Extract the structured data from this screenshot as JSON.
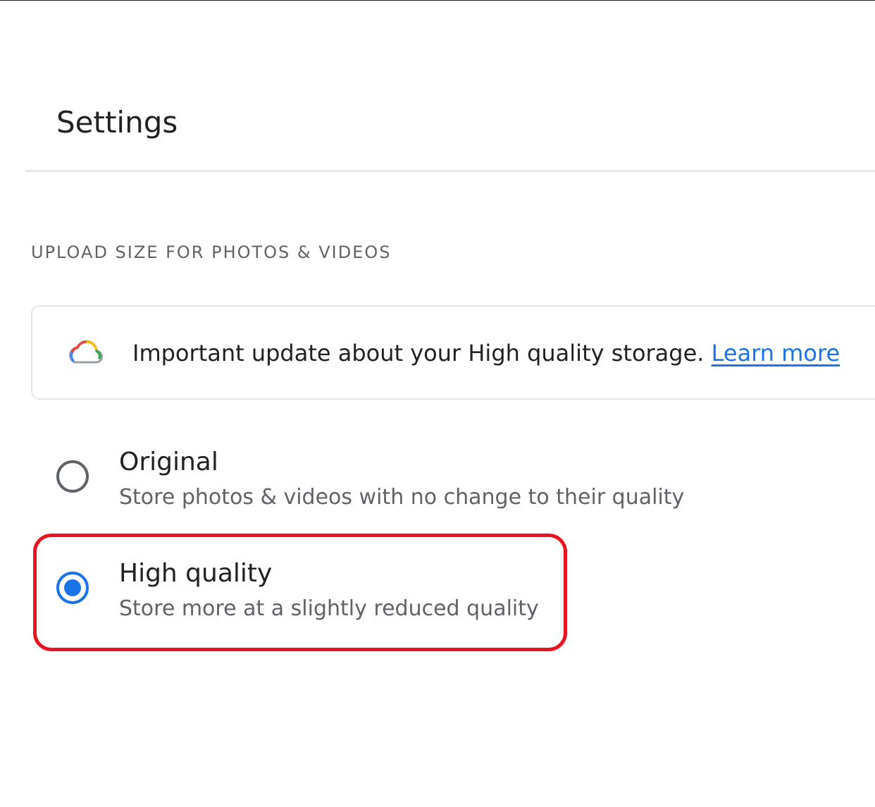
{
  "header": {
    "title": "Settings"
  },
  "section": {
    "heading": "UPLOAD SIZE FOR PHOTOS & VIDEOS"
  },
  "notice": {
    "icon": "cloud-icon",
    "text": "Important update about your High quality storage.",
    "link_label": "Learn more"
  },
  "options": [
    {
      "title": "Original",
      "description": "Store photos & videos with no change to their quality",
      "selected": false
    },
    {
      "title": "High quality",
      "description": "Store more at a slightly reduced quality",
      "selected": true
    }
  ],
  "colors": {
    "accent": "#1a73e8",
    "highlight_outline": "#e8141f",
    "primary_text": "#202124",
    "secondary_text": "#5f6368"
  }
}
